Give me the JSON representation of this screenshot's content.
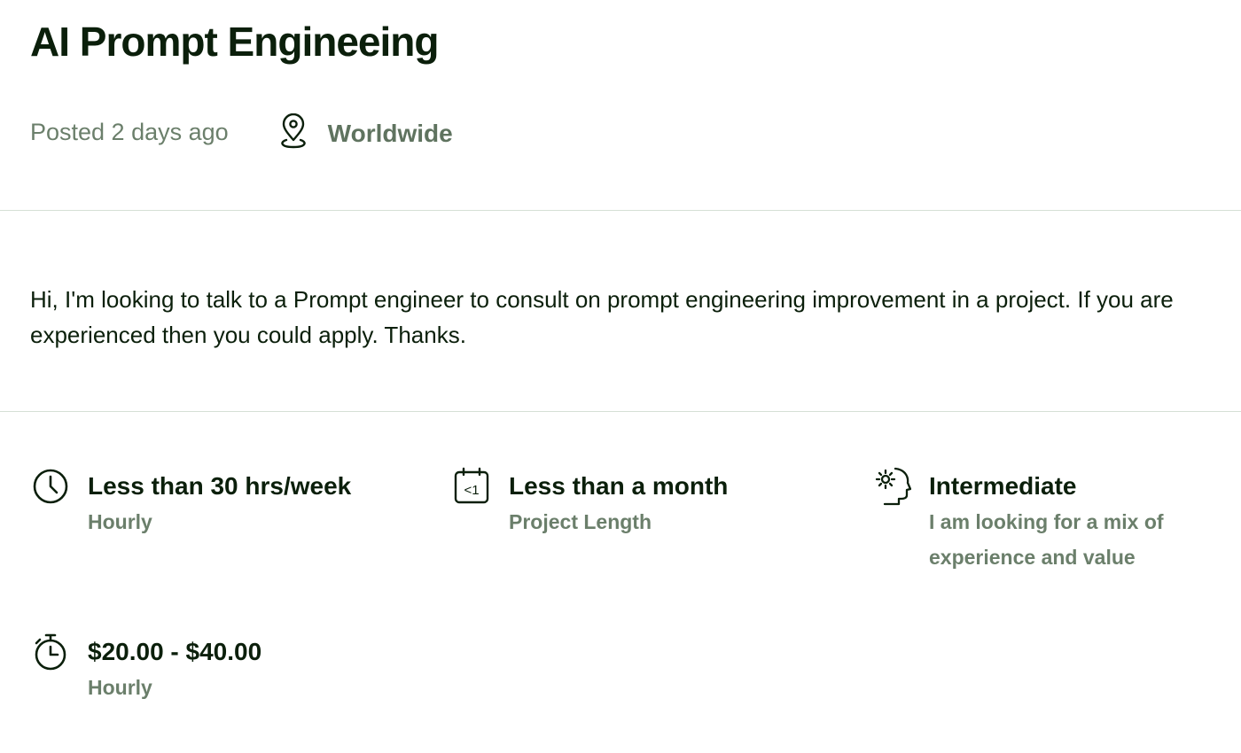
{
  "job": {
    "title": "AI Prompt Engineeing",
    "posted": "Posted 2 days ago",
    "location": "Worldwide",
    "location_icon": "map-pin-icon",
    "description": "Hi, I'm looking to talk to a Prompt engineer to consult on prompt engineering improvement in a project. If you are experienced then you could apply. Thanks."
  },
  "features": [
    {
      "icon": "clock-icon",
      "main": "Less than 30 hrs/week",
      "sub": "Hourly"
    },
    {
      "icon": "calendar-icon",
      "icon_text": "<1",
      "main": "Less than a month",
      "sub": "Project Length"
    },
    {
      "icon": "expertise-head-gear-icon",
      "main": "Intermediate",
      "sub": "I am looking for a mix of experience and value"
    },
    {
      "icon": "stopwatch-icon",
      "main": "$20.00 - $40.00",
      "sub": "Hourly"
    }
  ],
  "colors": {
    "text_primary": "#0b1f0b",
    "text_muted": "#6b7f6b",
    "divider": "#d5e0d5"
  }
}
